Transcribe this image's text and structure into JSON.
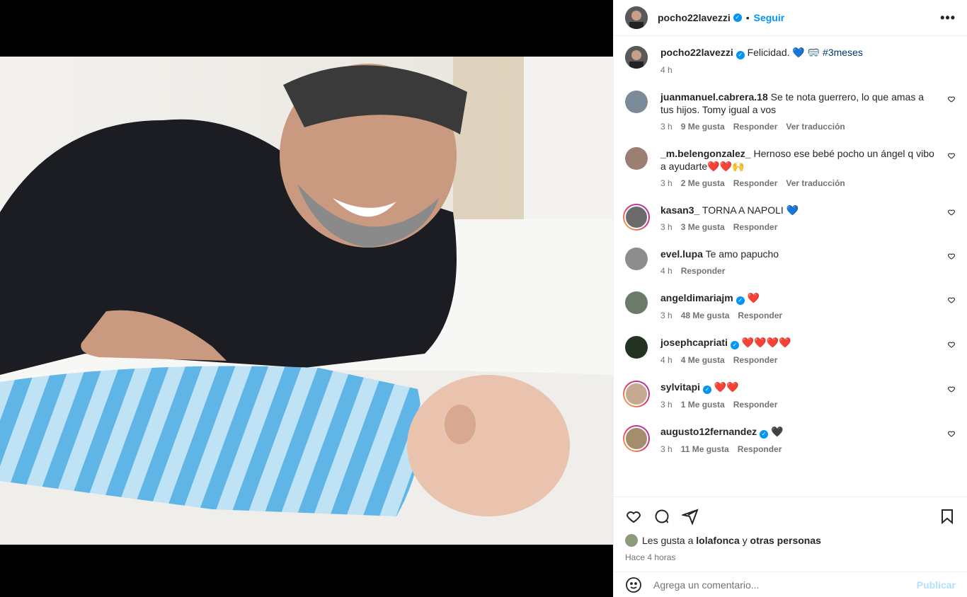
{
  "post": {
    "username": "pocho22lavezzi",
    "follow_label": "Seguir",
    "dot": "•",
    "caption_text": "Felicidad. 💙 🥽",
    "caption_hashtag": "#3meses",
    "caption_time": "4 h"
  },
  "comments": [
    {
      "user": "juanmanuel.cabrera.18",
      "verified": false,
      "text": "Se te nota guerrero, lo que amas a tus hijos. Tomy igual a vos",
      "time": "3 h",
      "likes": "9 Me gusta",
      "reply": "Responder",
      "translate": "Ver traducción",
      "ring": false
    },
    {
      "user": "_m.belengonzalez_",
      "verified": false,
      "text": "Hernoso ese bebé pocho un ángel q vibo a ayudarte❤️❤️🙌",
      "time": "3 h",
      "likes": "2 Me gusta",
      "reply": "Responder",
      "translate": "Ver traducción",
      "ring": false
    },
    {
      "user": "kasan3_",
      "verified": false,
      "text": "TORNA A NAPOLI 💙",
      "time": "3 h",
      "likes": "3 Me gusta",
      "reply": "Responder",
      "translate": "",
      "ring": true
    },
    {
      "user": "evel.lupa",
      "verified": false,
      "text": "Te amo papucho",
      "time": "4 h",
      "likes": "",
      "reply": "Responder",
      "translate": "",
      "ring": false
    },
    {
      "user": "angeldimariajm",
      "verified": true,
      "text": "❤️",
      "time": "3 h",
      "likes": "48 Me gusta",
      "reply": "Responder",
      "translate": "",
      "ring": false
    },
    {
      "user": "josephcapriati",
      "verified": true,
      "text": "❤️❤️❤️❤️",
      "time": "4 h",
      "likes": "4 Me gusta",
      "reply": "Responder",
      "translate": "",
      "ring": false
    },
    {
      "user": "sylvitapi",
      "verified": true,
      "text": "❤️❤️",
      "time": "3 h",
      "likes": "1 Me gusta",
      "reply": "Responder",
      "translate": "",
      "ring": true
    },
    {
      "user": "augusto12fernandez",
      "verified": true,
      "text": "🖤",
      "time": "3 h",
      "likes": "11 Me gusta",
      "reply": "Responder",
      "translate": "",
      "ring": true
    }
  ],
  "likes_line": {
    "prefix": "Les gusta a",
    "user": "lolafonca",
    "connector": "y",
    "others": "otras personas"
  },
  "posted_ago": "Hace 4 horas",
  "add_comment": {
    "placeholder": "Agrega un comentario...",
    "publish": "Publicar"
  },
  "colors": {
    "accent": "#0095f6",
    "heart": "#e0245e"
  }
}
